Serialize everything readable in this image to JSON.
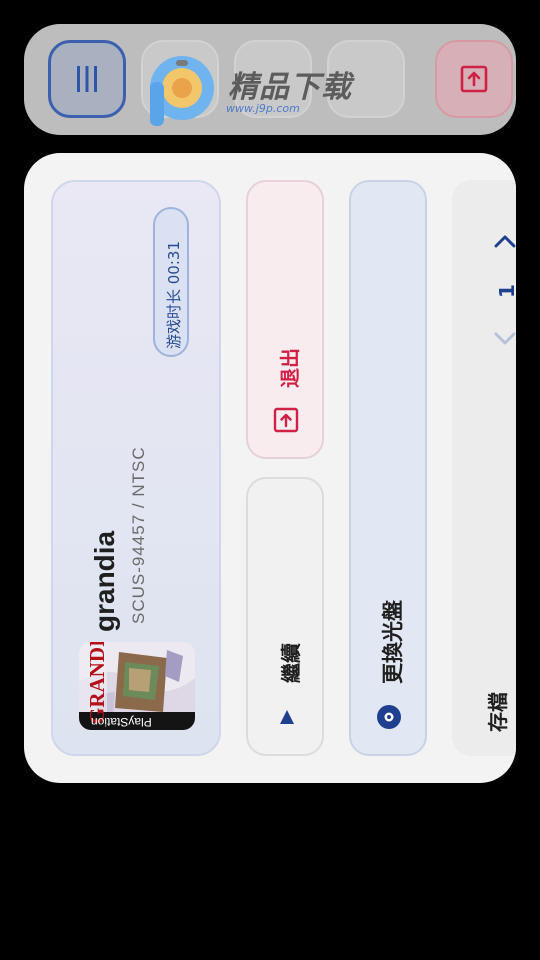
{
  "toolbar": {
    "buttons": [
      {
        "name": "menu",
        "icon": "vertical-bars-icon"
      },
      {
        "name": "button-2",
        "icon": ""
      },
      {
        "name": "button-3",
        "icon": ""
      },
      {
        "name": "button-4",
        "icon": ""
      },
      {
        "name": "exit",
        "icon": "exit-box-icon"
      }
    ]
  },
  "watermark": {
    "title": "精品下载",
    "url": "www.j9p.com"
  },
  "game": {
    "title": "grandia",
    "serial": "SCUS-94457 / NTSC",
    "playtime": "游戏时长 00:31",
    "cover_logo": "GRANDIA",
    "cover_brand": "PlayStation"
  },
  "actions": {
    "quit_label": "退出",
    "continue_label": "繼續",
    "swap_disc_label": "更換光盤",
    "save_label": "存檔"
  },
  "slots": {
    "current": "1"
  },
  "colors": {
    "accent": "#1f3f8f",
    "danger": "#d02046",
    "toolbar_bg": "#bdbdbd",
    "panel_bg": "#f3f3f3"
  }
}
